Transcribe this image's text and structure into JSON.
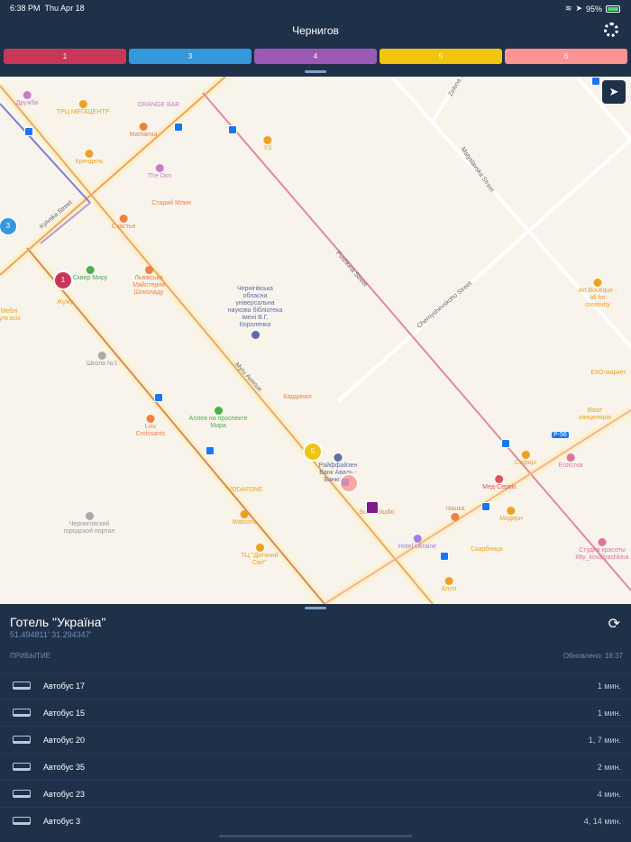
{
  "status": {
    "time": "6:38 PM",
    "date": "Thu Apr 18",
    "battery": "95%"
  },
  "header": {
    "title": "Чернигов"
  },
  "routes": [
    {
      "label": "1",
      "color": "#c8375a"
    },
    {
      "label": "3",
      "color": "#3498db"
    },
    {
      "label": "4",
      "color": "#9b59b6"
    },
    {
      "label": "5",
      "color": "#f1c40f"
    },
    {
      "label": "6",
      "color": "#fc9494"
    }
  ],
  "map": {
    "streets": [
      "Kyivska Street",
      "Myru Avenue",
      "Pushkina Street",
      "Mstyslavska Street",
      "Chernyshevskoho Street",
      "Zelena St",
      "P-56"
    ],
    "pois": [
      "Дружба",
      "ТРЦ МЕГАЦЕНТР",
      "ORANGE BAR",
      "Mamamia",
      "XS",
      "Крендель",
      "The Dim",
      "Старий Млин",
      "Счастье",
      "Сквер Миру",
      "Львівська Майстерня Шоколаду",
      "Жужу",
      "Меблі для всіх",
      "Чернігівська обласна універсальна наукова бібліотека імені В.Г. Короленка",
      "Школа №1",
      "Кардинал",
      "Аллея на проспекте Мира",
      "Lviv Croissants",
      "Райффайзен Банк Аваль - Банкомат",
      "VODAFONE",
      "Watsons",
      "Sushi Studio",
      "ТЦ \"Дитячий Світ\"",
      "Черниговский городской портал",
      "Art Boutique - all for creativity",
      "ЕКО-маркет",
      "Віват канцелярія",
      "Сафарі",
      "Егоїстка",
      "Мед-Сервіс",
      "Чашка",
      "Модерн",
      "Hotel Ukraine",
      "Скарбниця",
      "Студия красоты #by_kovalyashkina",
      "Алло"
    ],
    "vehicles": [
      "1",
      "3",
      "5"
    ]
  },
  "panel": {
    "stop_name": "Готель \"Україна\"",
    "coords": "51.494811' 31.294347'",
    "arrival_label": "ПРИБЫТИЕ",
    "updated": "Обновлено: 18:37",
    "arrivals": [
      {
        "name": "Автобус 17",
        "time": "1 мин."
      },
      {
        "name": "Автобус 15",
        "time": "1 мин."
      },
      {
        "name": "Автобус 20",
        "time": "1, 7 мин."
      },
      {
        "name": "Автобус 35",
        "time": "2 мин."
      },
      {
        "name": "Автобус 23",
        "time": "4 мин."
      },
      {
        "name": "Автобус 3",
        "time": "4, 14 мин."
      }
    ]
  }
}
